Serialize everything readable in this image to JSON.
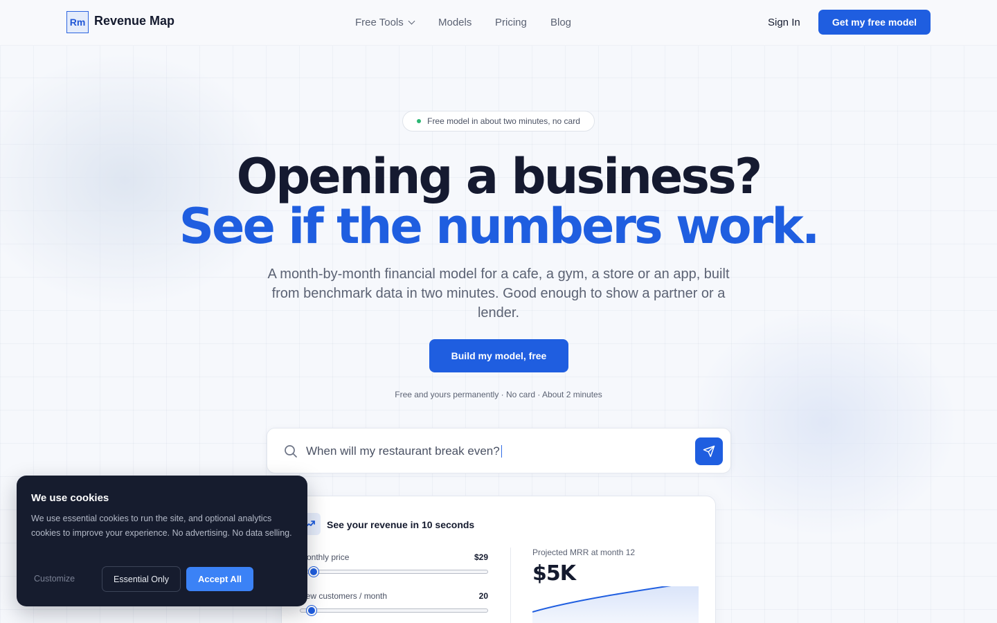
{
  "header": {
    "logo_mark": "Rm",
    "brand": "Revenue Map",
    "nav": [
      {
        "label": "Free Tools",
        "has_dropdown": true
      },
      {
        "label": "Models"
      },
      {
        "label": "Pricing"
      },
      {
        "label": "Blog"
      }
    ],
    "sign_in": "Sign In",
    "cta": "Get my free model"
  },
  "hero": {
    "badge": "Free model in about two minutes, no card",
    "headline_1": "Opening a business?",
    "headline_2": "See if the numbers work.",
    "subtitle": "A month-by-month financial model for a cafe, a gym, a store or an app, built from benchmark data in two minutes. Good enough to show a partner or a lender.",
    "cta": "Build my model, free",
    "fine_print": "Free and yours permanently · No card · About 2 minutes"
  },
  "search": {
    "value": "When will my restaurant break even?",
    "icon": "search-icon",
    "submit_icon": "send-icon"
  },
  "demo_card": {
    "title": "See your revenue in 10 seconds",
    "sliders": [
      {
        "label": "Monthly price",
        "value": "$29",
        "fraction": 0.07
      },
      {
        "label": "New customers / month",
        "value": "20",
        "fraction": 0.06
      }
    ],
    "mrr_label": "Projected MRR at month 12",
    "mrr_value": "$5K"
  },
  "cookie": {
    "title": "We use cookies",
    "body": "We use essential cookies to run the site, and optional analytics cookies to improve your experience. No advertising. No data selling.",
    "customize": "Customize",
    "essential": "Essential Only",
    "accept": "Accept All"
  },
  "colors": {
    "accent": "#1f5ee0",
    "headline": "#151a30",
    "cookie_bg": "#161c2e",
    "cookie_accept": "#3b82f6",
    "badge_dot": "#2bb673"
  }
}
